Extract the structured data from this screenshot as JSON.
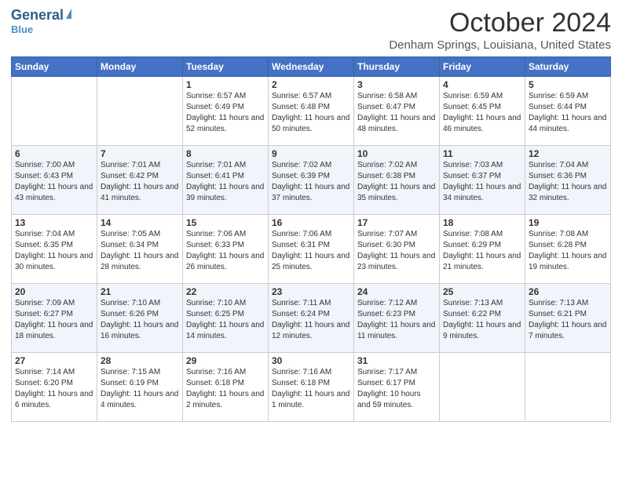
{
  "logo": {
    "line1": "General",
    "line2": "Blue"
  },
  "title": "October 2024",
  "subtitle": "Denham Springs, Louisiana, United States",
  "days_of_week": [
    "Sunday",
    "Monday",
    "Tuesday",
    "Wednesday",
    "Thursday",
    "Friday",
    "Saturday"
  ],
  "weeks": [
    [
      {
        "day": "",
        "info": ""
      },
      {
        "day": "",
        "info": ""
      },
      {
        "day": "1",
        "info": "Sunrise: 6:57 AM\nSunset: 6:49 PM\nDaylight: 11 hours and 52 minutes."
      },
      {
        "day": "2",
        "info": "Sunrise: 6:57 AM\nSunset: 6:48 PM\nDaylight: 11 hours and 50 minutes."
      },
      {
        "day": "3",
        "info": "Sunrise: 6:58 AM\nSunset: 6:47 PM\nDaylight: 11 hours and 48 minutes."
      },
      {
        "day": "4",
        "info": "Sunrise: 6:59 AM\nSunset: 6:45 PM\nDaylight: 11 hours and 46 minutes."
      },
      {
        "day": "5",
        "info": "Sunrise: 6:59 AM\nSunset: 6:44 PM\nDaylight: 11 hours and 44 minutes."
      }
    ],
    [
      {
        "day": "6",
        "info": "Sunrise: 7:00 AM\nSunset: 6:43 PM\nDaylight: 11 hours and 43 minutes."
      },
      {
        "day": "7",
        "info": "Sunrise: 7:01 AM\nSunset: 6:42 PM\nDaylight: 11 hours and 41 minutes."
      },
      {
        "day": "8",
        "info": "Sunrise: 7:01 AM\nSunset: 6:41 PM\nDaylight: 11 hours and 39 minutes."
      },
      {
        "day": "9",
        "info": "Sunrise: 7:02 AM\nSunset: 6:39 PM\nDaylight: 11 hours and 37 minutes."
      },
      {
        "day": "10",
        "info": "Sunrise: 7:02 AM\nSunset: 6:38 PM\nDaylight: 11 hours and 35 minutes."
      },
      {
        "day": "11",
        "info": "Sunrise: 7:03 AM\nSunset: 6:37 PM\nDaylight: 11 hours and 34 minutes."
      },
      {
        "day": "12",
        "info": "Sunrise: 7:04 AM\nSunset: 6:36 PM\nDaylight: 11 hours and 32 minutes."
      }
    ],
    [
      {
        "day": "13",
        "info": "Sunrise: 7:04 AM\nSunset: 6:35 PM\nDaylight: 11 hours and 30 minutes."
      },
      {
        "day": "14",
        "info": "Sunrise: 7:05 AM\nSunset: 6:34 PM\nDaylight: 11 hours and 28 minutes."
      },
      {
        "day": "15",
        "info": "Sunrise: 7:06 AM\nSunset: 6:33 PM\nDaylight: 11 hours and 26 minutes."
      },
      {
        "day": "16",
        "info": "Sunrise: 7:06 AM\nSunset: 6:31 PM\nDaylight: 11 hours and 25 minutes."
      },
      {
        "day": "17",
        "info": "Sunrise: 7:07 AM\nSunset: 6:30 PM\nDaylight: 11 hours and 23 minutes."
      },
      {
        "day": "18",
        "info": "Sunrise: 7:08 AM\nSunset: 6:29 PM\nDaylight: 11 hours and 21 minutes."
      },
      {
        "day": "19",
        "info": "Sunrise: 7:08 AM\nSunset: 6:28 PM\nDaylight: 11 hours and 19 minutes."
      }
    ],
    [
      {
        "day": "20",
        "info": "Sunrise: 7:09 AM\nSunset: 6:27 PM\nDaylight: 11 hours and 18 minutes."
      },
      {
        "day": "21",
        "info": "Sunrise: 7:10 AM\nSunset: 6:26 PM\nDaylight: 11 hours and 16 minutes."
      },
      {
        "day": "22",
        "info": "Sunrise: 7:10 AM\nSunset: 6:25 PM\nDaylight: 11 hours and 14 minutes."
      },
      {
        "day": "23",
        "info": "Sunrise: 7:11 AM\nSunset: 6:24 PM\nDaylight: 11 hours and 12 minutes."
      },
      {
        "day": "24",
        "info": "Sunrise: 7:12 AM\nSunset: 6:23 PM\nDaylight: 11 hours and 11 minutes."
      },
      {
        "day": "25",
        "info": "Sunrise: 7:13 AM\nSunset: 6:22 PM\nDaylight: 11 hours and 9 minutes."
      },
      {
        "day": "26",
        "info": "Sunrise: 7:13 AM\nSunset: 6:21 PM\nDaylight: 11 hours and 7 minutes."
      }
    ],
    [
      {
        "day": "27",
        "info": "Sunrise: 7:14 AM\nSunset: 6:20 PM\nDaylight: 11 hours and 6 minutes."
      },
      {
        "day": "28",
        "info": "Sunrise: 7:15 AM\nSunset: 6:19 PM\nDaylight: 11 hours and 4 minutes."
      },
      {
        "day": "29",
        "info": "Sunrise: 7:16 AM\nSunset: 6:18 PM\nDaylight: 11 hours and 2 minutes."
      },
      {
        "day": "30",
        "info": "Sunrise: 7:16 AM\nSunset: 6:18 PM\nDaylight: 11 hours and 1 minute."
      },
      {
        "day": "31",
        "info": "Sunrise: 7:17 AM\nSunset: 6:17 PM\nDaylight: 10 hours and 59 minutes."
      },
      {
        "day": "",
        "info": ""
      },
      {
        "day": "",
        "info": ""
      }
    ]
  ]
}
